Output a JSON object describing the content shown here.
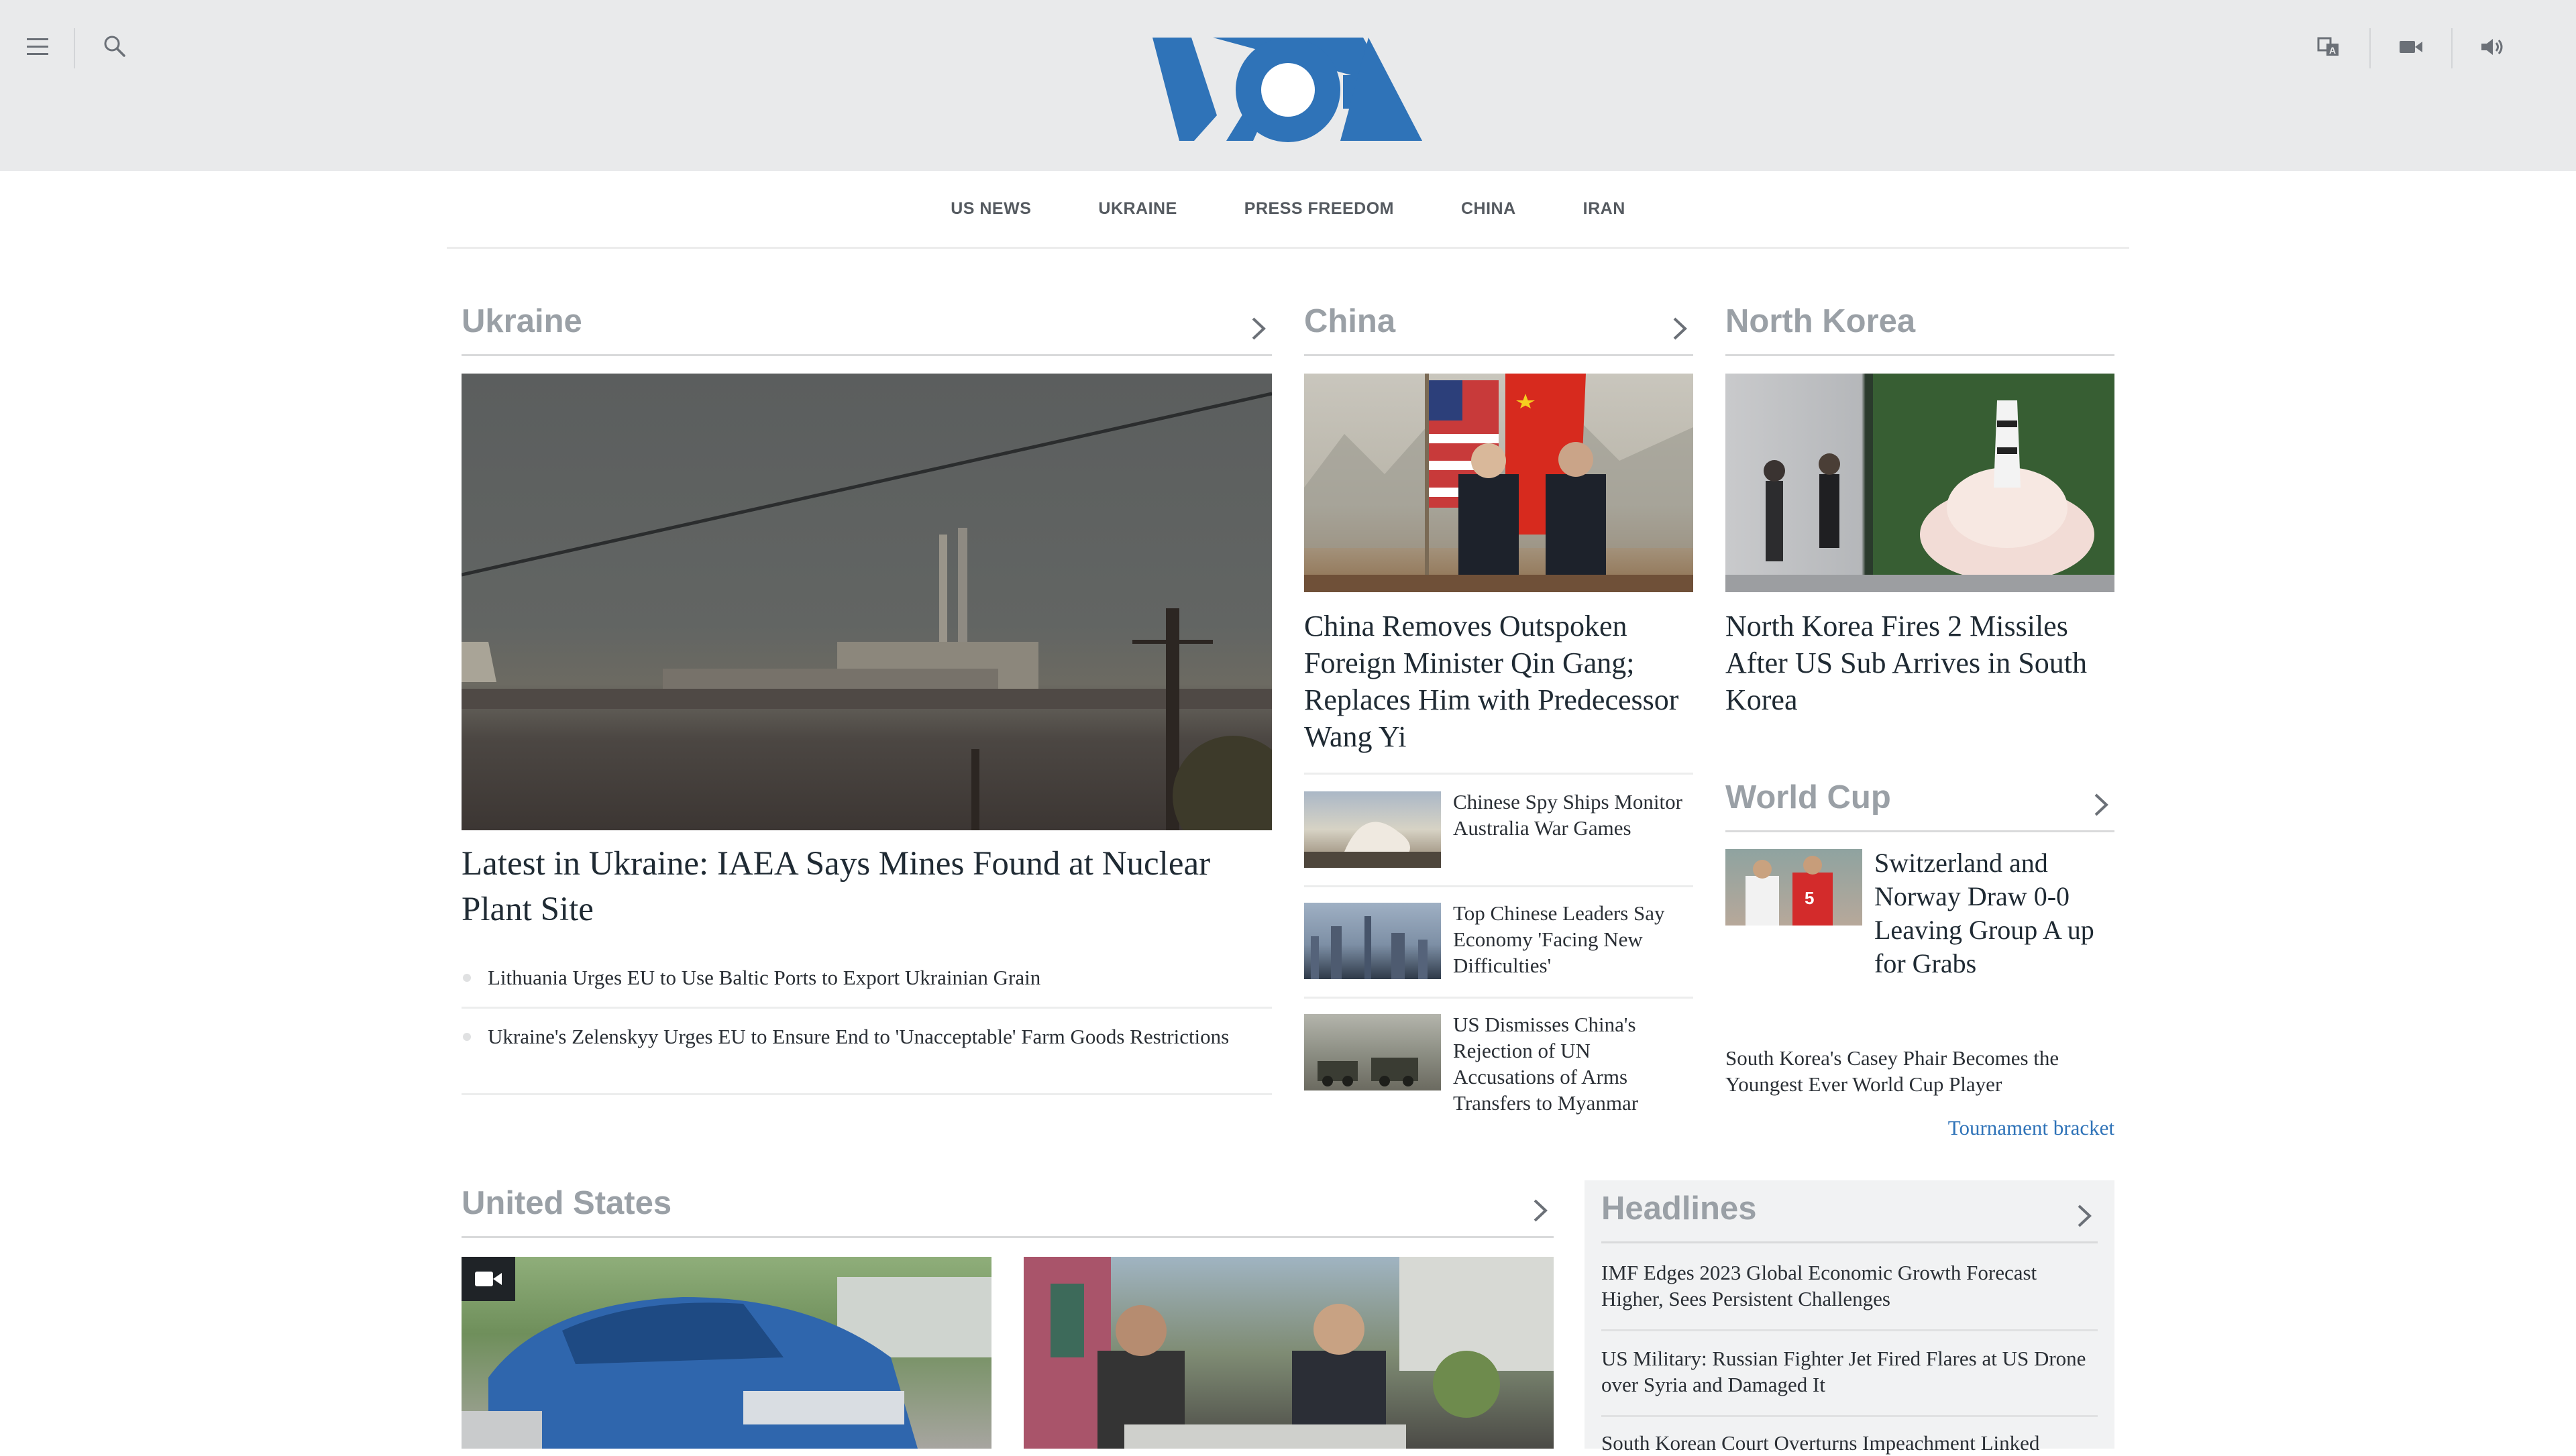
{
  "header": {
    "menu_icon": "menu-icon",
    "search_icon": "search-icon",
    "logo_text": "VOA",
    "language_icon": "language-icon",
    "video_icon": "video-camera-icon",
    "audio_icon": "speaker-icon"
  },
  "nav": {
    "items": [
      "US NEWS",
      "UKRAINE",
      "PRESS FREEDOM",
      "CHINA",
      "IRAN"
    ]
  },
  "ukraine": {
    "title": "Ukraine",
    "main_headline": "Latest in Ukraine: IAEA Says Mines Found at Nuclear Plant Site",
    "list": [
      "Lithuania Urges EU to Use Baltic Ports to Export Ukrainian Grain",
      "Ukraine's Zelenskyy Urges EU to Ensure End to 'Unacceptable' Farm Goods Restrictions"
    ]
  },
  "china": {
    "title": "China",
    "main_headline": "China Removes Outspoken Foreign Minister Qin Gang; Replaces Him with Predecessor Wang Yi",
    "items": [
      "Chinese Spy Ships Monitor Australia War Games",
      "Top Chinese Leaders Say Economy 'Facing New Difficulties'",
      "US Dismisses China's Rejection of UN Accusations of Arms Transfers to Myanmar"
    ]
  },
  "north_korea": {
    "title": "North Korea",
    "main_headline": "North Korea Fires 2 Missiles After US Sub Arrives in South Korea"
  },
  "world_cup": {
    "title": "World Cup",
    "main_headline": "Switzerland and Norway Draw 0-0 Leaving Group A up for Grabs",
    "item": "South Korea's Casey Phair Becomes the Youngest Ever World Cup Player",
    "link": "Tournament bracket"
  },
  "united_states": {
    "title": "United States"
  },
  "headlines": {
    "title": "Headlines",
    "items": [
      "IMF Edges 2023 Global Economic Growth Forecast Higher, Sees Persistent Challenges",
      "US Military: Russian Fighter Jet Fired Flares at US Drone over Syria and Damaged It",
      "South Korean Court Overturns Impeachment Linked"
    ]
  },
  "colors": {
    "brand_blue": "#2f73b8",
    "header_bg": "#e9eaeb",
    "section_title": "#9aa0a6"
  }
}
